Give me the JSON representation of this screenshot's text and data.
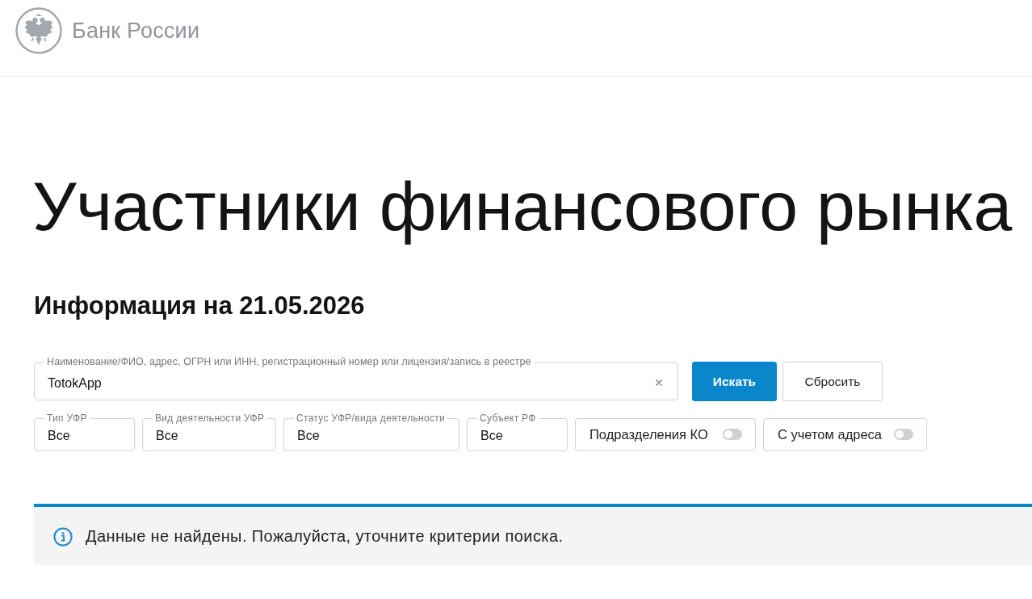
{
  "header": {
    "logo_text": "Банк России"
  },
  "title": "Участники финансового рынка",
  "subtitle": "Информация на 21.05.2026",
  "search": {
    "label": "Наименование/ФИО, адрес, ОГРН или ИНН, регистрационный номер или лицензия/запись в реестре",
    "value": "TotokApp"
  },
  "buttons": [
    {
      "label": "Искать",
      "kind": "primary"
    },
    {
      "label": "Сбросить",
      "kind": "secondary"
    }
  ],
  "filters": [
    {
      "kind": "select",
      "label": "Тип УФР",
      "value": "Все"
    },
    {
      "kind": "select",
      "label": "Вид деятельности УФР",
      "value": "Все"
    },
    {
      "kind": "select",
      "label": "Статус УФР/вида деятельности",
      "value": "Все"
    },
    {
      "kind": "select",
      "label": "Субъект РФ",
      "value": "Все"
    },
    {
      "kind": "toggle",
      "label": "Подразделения КО",
      "on": false
    },
    {
      "kind": "toggle",
      "label": "С учетом адреса",
      "on": false
    }
  ],
  "alert": {
    "text": "Данные не найдены. Пожалуйста, уточните критерии поиска."
  }
}
